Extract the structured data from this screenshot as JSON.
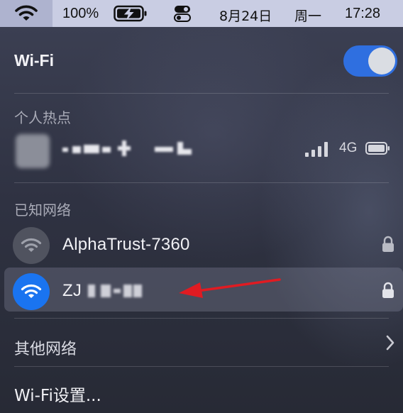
{
  "menubar": {
    "battery_percent": "100%",
    "date": "8月24日",
    "weekday": "周一",
    "time": "17:28",
    "icons": [
      "wifi-icon",
      "battery-charging-icon",
      "control-center-icon"
    ]
  },
  "wifi_panel": {
    "title": "Wi-Fi",
    "enabled": true,
    "accent_color": "#2f6fe0",
    "personal_hotspot": {
      "header": "个人热点",
      "network_type": "4G"
    },
    "known_networks": {
      "header": "已知网络",
      "items": [
        {
          "name": "AlphaTrust-7360",
          "locked": true,
          "connected": false
        },
        {
          "name": "ZJ",
          "locked": true,
          "connected": true
        }
      ]
    },
    "other_networks_label": "其他网络",
    "settings_label": "Wi-Fi设置..."
  },
  "annotation": {
    "color": "#e01b22"
  }
}
